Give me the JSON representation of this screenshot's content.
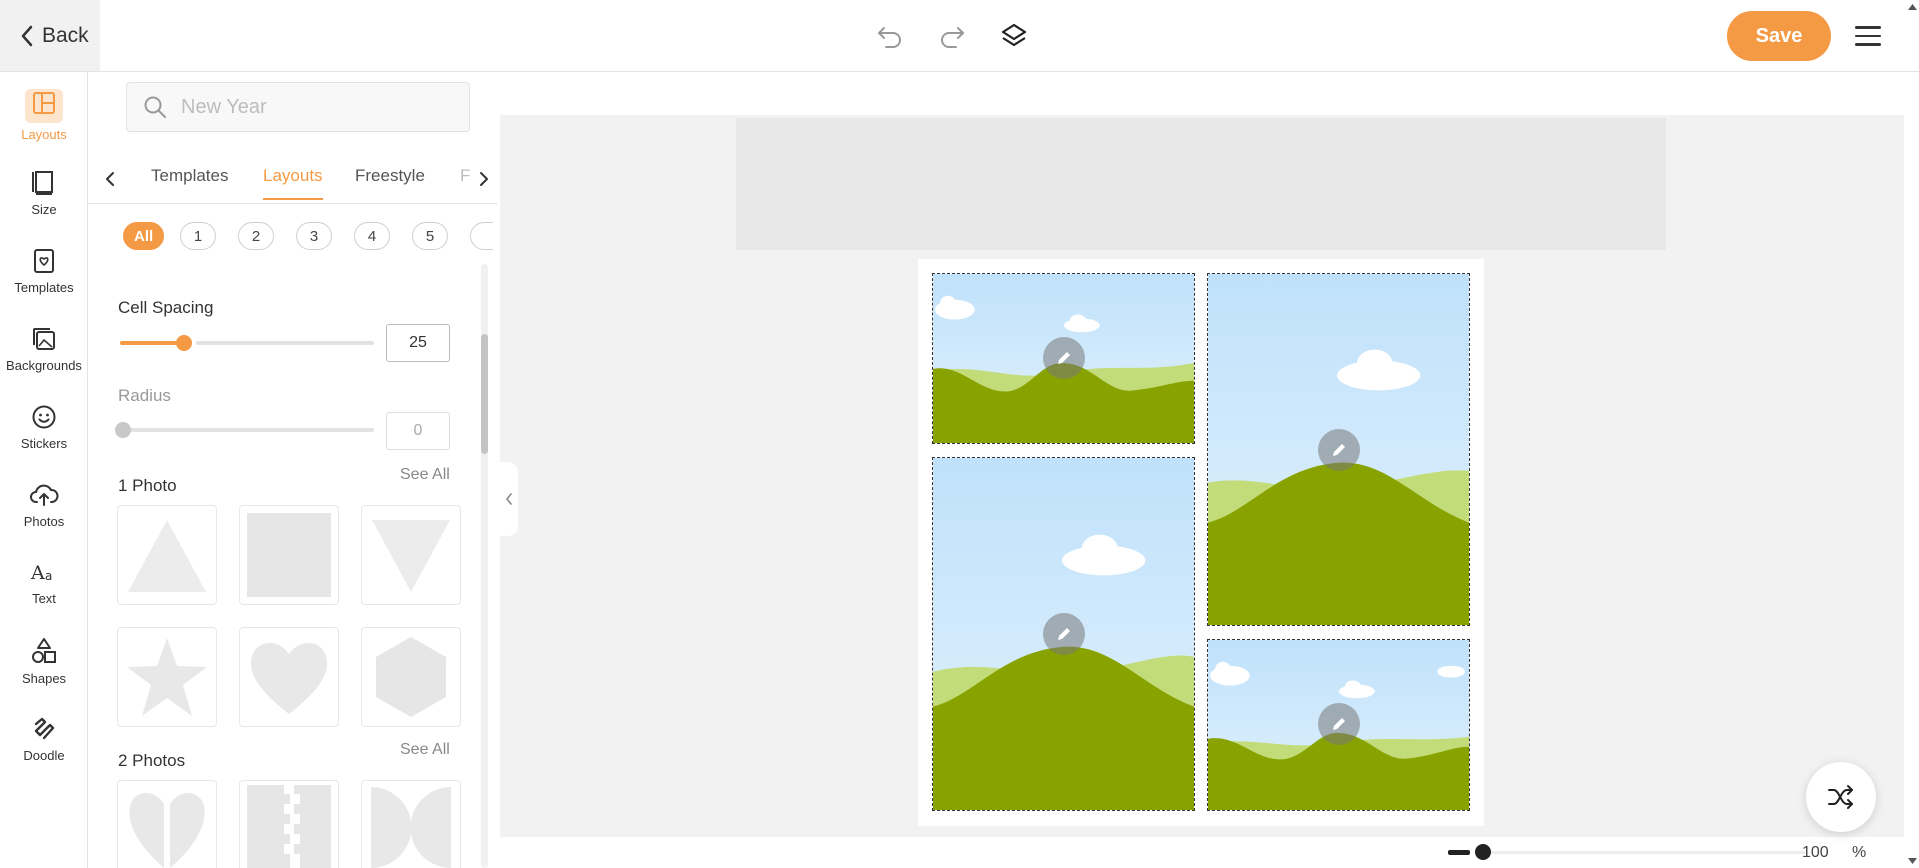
{
  "topbar": {
    "back_label": "Back",
    "save_label": "Save"
  },
  "rail": {
    "items": [
      {
        "label": "Layouts",
        "icon": "layouts-icon",
        "active": true
      },
      {
        "label": "Size",
        "icon": "size-icon"
      },
      {
        "label": "Templates",
        "icon": "templates-icon"
      },
      {
        "label": "Backgrounds",
        "icon": "backgrounds-icon"
      },
      {
        "label": "Stickers",
        "icon": "stickers-icon"
      },
      {
        "label": "Photos",
        "icon": "photos-icon"
      },
      {
        "label": "Text",
        "icon": "text-icon"
      },
      {
        "label": "Shapes",
        "icon": "shapes-icon"
      },
      {
        "label": "Doodle",
        "icon": "doodle-icon"
      }
    ]
  },
  "panel": {
    "search_placeholder": "New Year",
    "tabs": [
      "Templates",
      "Layouts",
      "Freestyle",
      "F"
    ],
    "active_tab": "Layouts",
    "chips": [
      "All",
      "1",
      "2",
      "3",
      "4",
      "5"
    ],
    "cell_spacing_label": "Cell Spacing",
    "cell_spacing_value": "25",
    "cell_spacing_fraction": 0.25,
    "radius_label": "Radius",
    "radius_value": "0",
    "section_1_title": "1 Photo",
    "section_2_title": "2 Photos",
    "see_all": "See All"
  },
  "zoom": {
    "value": "100",
    "unit": "%"
  },
  "colors": {
    "accent": "#f49a45",
    "sky": "#cfe8fb",
    "hill_dark": "#88a300",
    "hill_light": "#c3dc7a"
  }
}
